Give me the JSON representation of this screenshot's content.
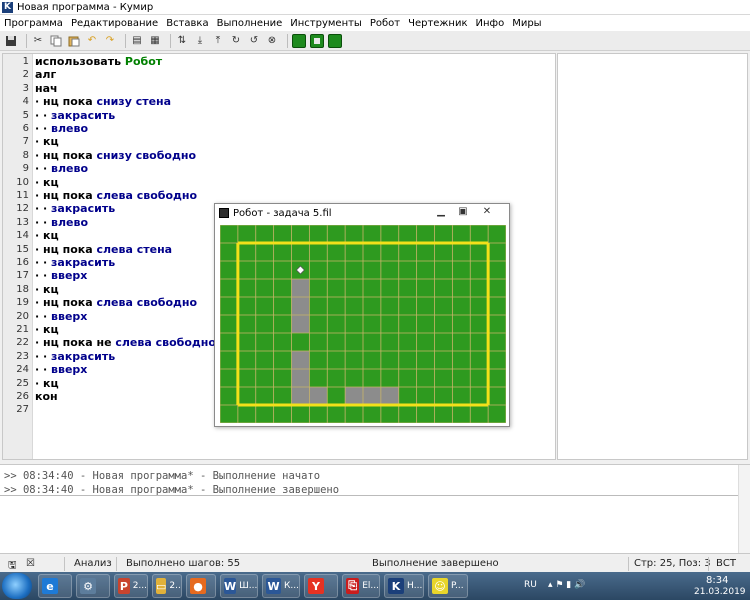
{
  "window": {
    "title": "Новая программа - Кумир",
    "app_icon": "K"
  },
  "menu": [
    "Программа",
    "Редактирование",
    "Вставка",
    "Выполнение",
    "Инструменты",
    "Робот",
    "Чертежник",
    "Инфо",
    "Миры"
  ],
  "toolbar_icons": [
    "save-icon",
    "cut-icon",
    "copy-icon",
    "paste-icon",
    "undo-icon",
    "redo-icon",
    "insert-icon",
    "insert-icon",
    "step-icon",
    "step-in-icon",
    "step-out-icon",
    "run-icon",
    "pause-icon",
    "stop-icon",
    "grid-icon",
    "frame-icon",
    "grid-icon"
  ],
  "editor": {
    "lines": [
      {
        "n": "1",
        "tokens": [
          {
            "t": " использовать ",
            "c": "kw"
          },
          {
            "t": "Робот",
            "c": "mod"
          }
        ]
      },
      {
        "n": "2",
        "tokens": [
          {
            "t": "алг",
            "c": "kw"
          }
        ]
      },
      {
        "n": "3",
        "tokens": [
          {
            "t": "нач",
            "c": "kw"
          }
        ]
      },
      {
        "n": "4",
        "tokens": [
          {
            "t": "· нц пока ",
            "c": "kw"
          },
          {
            "t": "снизу стена",
            "c": "cmd"
          }
        ]
      },
      {
        "n": "5",
        "tokens": [
          {
            "t": "· · ",
            "c": "kw"
          },
          {
            "t": "закрасить",
            "c": "cmd"
          }
        ]
      },
      {
        "n": "6",
        "tokens": [
          {
            "t": "· · ",
            "c": "kw"
          },
          {
            "t": "влево",
            "c": "cmd"
          }
        ]
      },
      {
        "n": "7",
        "tokens": [
          {
            "t": "· кц",
            "c": "kw"
          }
        ]
      },
      {
        "n": "8",
        "tokens": [
          {
            "t": "· нц пока ",
            "c": "kw"
          },
          {
            "t": "снизу свободно",
            "c": "cmd"
          }
        ]
      },
      {
        "n": "9",
        "tokens": [
          {
            "t": "· ·  ",
            "c": "kw"
          },
          {
            "t": "влево",
            "c": "cmd"
          }
        ]
      },
      {
        "n": "10",
        "tokens": [
          {
            "t": "· кц",
            "c": "kw"
          }
        ]
      },
      {
        "n": "11",
        "tokens": [
          {
            "t": "· нц пока ",
            "c": "kw"
          },
          {
            "t": "слева свободно",
            "c": "cmd"
          }
        ]
      },
      {
        "n": "12",
        "tokens": [
          {
            "t": "· · ",
            "c": "kw"
          },
          {
            "t": "закрасить",
            "c": "cmd"
          }
        ]
      },
      {
        "n": "13",
        "tokens": [
          {
            "t": "· · ",
            "c": "kw"
          },
          {
            "t": "влево",
            "c": "cmd"
          }
        ]
      },
      {
        "n": "14",
        "tokens": [
          {
            "t": "· кц",
            "c": "kw"
          }
        ]
      },
      {
        "n": "15",
        "tokens": [
          {
            "t": "· нц пока  ",
            "c": "kw"
          },
          {
            "t": "слева стена",
            "c": "cmd"
          }
        ]
      },
      {
        "n": "16",
        "tokens": [
          {
            "t": "· · ",
            "c": "kw"
          },
          {
            "t": "закрасить",
            "c": "cmd"
          }
        ]
      },
      {
        "n": "17",
        "tokens": [
          {
            "t": "· · ",
            "c": "kw"
          },
          {
            "t": "вверх",
            "c": "cmd"
          }
        ]
      },
      {
        "n": "18",
        "tokens": [
          {
            "t": "· кц",
            "c": "kw"
          }
        ]
      },
      {
        "n": "19",
        "tokens": [
          {
            "t": "· нц пока ",
            "c": "kw"
          },
          {
            "t": "слева свободно",
            "c": "cmd"
          }
        ]
      },
      {
        "n": "20",
        "tokens": [
          {
            "t": "· · ",
            "c": "kw"
          },
          {
            "t": "вверх",
            "c": "cmd"
          }
        ]
      },
      {
        "n": "21",
        "tokens": [
          {
            "t": "· кц",
            "c": "kw"
          }
        ]
      },
      {
        "n": "22",
        "tokens": [
          {
            "t": "· нц пока не ",
            "c": "kw"
          },
          {
            "t": "слева свободно",
            "c": "cmd"
          }
        ]
      },
      {
        "n": "23",
        "tokens": [
          {
            "t": "· · ",
            "c": "kw"
          },
          {
            "t": "закрасить",
            "c": "cmd"
          }
        ]
      },
      {
        "n": "24",
        "tokens": [
          {
            "t": "· · ",
            "c": "kw"
          },
          {
            "t": "вверх",
            "c": "cmd"
          }
        ]
      },
      {
        "n": "25",
        "tokens": [
          {
            "t": "· кц",
            "c": "kw"
          }
        ]
      },
      {
        "n": "26",
        "tokens": [
          {
            "t": "кон",
            "c": "kw"
          }
        ]
      },
      {
        "n": "27",
        "tokens": []
      }
    ]
  },
  "robot_window": {
    "title": "Робот - задача 5.fil",
    "grid": {
      "cols": 16,
      "rows": 11
    },
    "colors": {
      "field": "#2e9a1f",
      "grid": "#c9b56a",
      "wall": "#f2e01a",
      "painted": "#8c8c8c",
      "robot": "#ffffff"
    },
    "walls": [
      {
        "from": [
          1,
          1
        ],
        "to": [
          15,
          1
        ]
      },
      {
        "from": [
          15,
          1
        ],
        "to": [
          15,
          10
        ]
      },
      {
        "from": [
          15,
          10
        ],
        "to": [
          1,
          10
        ]
      },
      {
        "from": [
          1,
          10
        ],
        "to": [
          1,
          1
        ]
      }
    ],
    "painted_cells": [
      [
        4,
        3
      ],
      [
        4,
        4
      ],
      [
        4,
        5
      ],
      [
        4,
        7
      ],
      [
        4,
        8
      ],
      [
        4,
        9
      ],
      [
        5,
        9
      ],
      [
        7,
        9
      ],
      [
        8,
        9
      ],
      [
        9,
        9
      ]
    ],
    "robot_cell": [
      4,
      2
    ]
  },
  "console": {
    "lines": [
      ">> 08:34:40 - Новая программа* - Выполнение начато",
      ">> 08:34:40 - Новая программа* - Выполнение завершено"
    ]
  },
  "status": {
    "mode": "Анализ",
    "steps": "Выполнено шагов: 55",
    "state": "Выполнение завершено",
    "position": "Стр: 25, Поз: 3",
    "insert": "ВСТ"
  },
  "taskbar": {
    "items": [
      {
        "icon": "ie-icon",
        "label": ""
      },
      {
        "icon": "tools-icon",
        "label": ""
      },
      {
        "icon": "presentation-icon",
        "label": "2..."
      },
      {
        "icon": "folder-icon",
        "label": "2..."
      },
      {
        "icon": "firefox-icon",
        "label": ""
      },
      {
        "icon": "word-icon",
        "label": "Ш..."
      },
      {
        "icon": "word-icon",
        "label": "К..."
      },
      {
        "icon": "yandex-icon",
        "label": ""
      },
      {
        "icon": "pdf-icon",
        "label": "El..."
      },
      {
        "icon": "kumir-icon",
        "label": "Н..."
      },
      {
        "icon": "robot-icon",
        "label": "P..."
      }
    ],
    "lang": "RU",
    "time": "8:34",
    "date": "21.03.2019"
  }
}
